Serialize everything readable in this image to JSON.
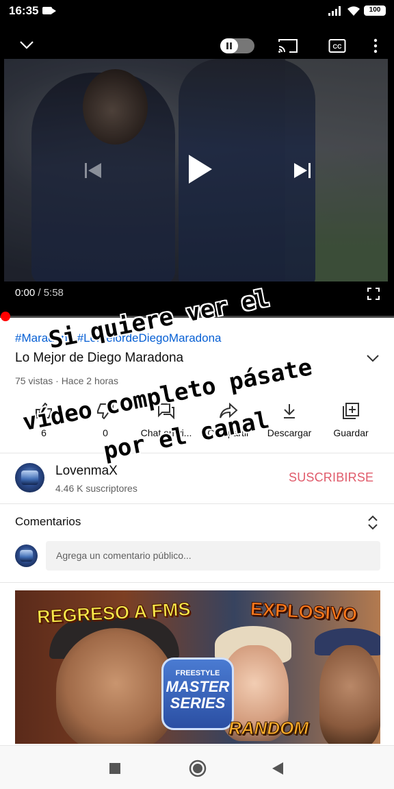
{
  "status_bar": {
    "time": "16:35",
    "battery": "100"
  },
  "player": {
    "current_time": "0:00",
    "duration": " / 5:58",
    "progress": 0.0,
    "icons": [
      "chevron-down-icon",
      "autoplay-toggle-icon",
      "cast-icon",
      "captions-icon",
      "more-vert-icon",
      "previous-icon",
      "play-icon",
      "next-icon",
      "fullscreen-icon"
    ],
    "accent": "#ff0000"
  },
  "video": {
    "hashtags": "#Maradona #LomeiordeDiegoMaradona",
    "title": "Lo Mejor de Diego Maradona",
    "meta": "75 vistas · Hace 2 horas"
  },
  "actions": {
    "like_count": "6",
    "dislike_count": "0",
    "chat": "Chat en vi...",
    "share": "Compartir",
    "download": "Descargar",
    "save": "Guardar"
  },
  "channel": {
    "name": "LovenmaX",
    "subscribers": "4.46 K suscriptores",
    "subscribe_label": "SUSCRIBIRSE",
    "subscribe_color": "#e05a6a"
  },
  "comments": {
    "heading": "Comentarios",
    "placeholder": "Agrega un comentario público..."
  },
  "thumbnail": {
    "left_text": "REGRESO A FMS",
    "right_text": "EXPLOSIVO",
    "badge_top": "FREESTYLE",
    "badge_main": "MASTER SERIES",
    "bottom_text": "RANDOM"
  },
  "overlay_text": {
    "line1": "Si quiere ver el",
    "line2": "vídeo completo pásate",
    "line3": "por el canal"
  }
}
